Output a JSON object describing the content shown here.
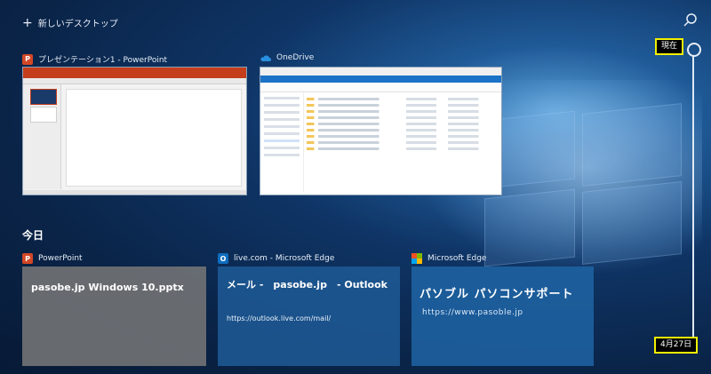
{
  "top_bar": {
    "new_desktop_label": "新しいデスクトップ",
    "plus_icon": "plus-icon",
    "search_icon": "search-icon"
  },
  "timeline": {
    "now_label": "現在",
    "date_label": "4月27日",
    "highlight_color": "#f2f000"
  },
  "open_windows": [
    {
      "title": "プレゼンテーション1 - PowerPoint",
      "icon": "powerpoint-icon",
      "accent": "#d24726"
    },
    {
      "title": "OneDrive",
      "icon": "onedrive-icon",
      "accent": "#1b72c7"
    }
  ],
  "section_today": "今日",
  "activities": [
    {
      "app": "PowerPoint",
      "icon": "powerpoint-icon",
      "line1": "pasobe.jp Windows 10.pptx"
    },
    {
      "app": "live.com - Microsoft Edge",
      "icon": "outlook-icon",
      "line1": "メール -　pasobe.jp　- Outlook",
      "url": "https://outlook.live.com/mail/"
    },
    {
      "app": "Microsoft Edge",
      "icon": "microsoft-logo-icon",
      "line1": "パソブル パソコンサポート",
      "url": "https://www.pasoble.jp"
    }
  ]
}
